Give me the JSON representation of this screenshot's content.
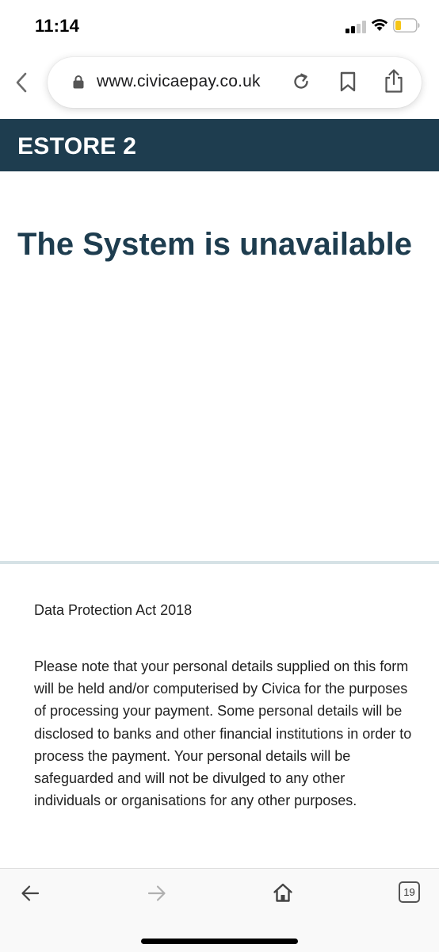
{
  "status_bar": {
    "time": "11:14",
    "icons": [
      "signal-icon",
      "wifi-icon",
      "battery-icon"
    ]
  },
  "browser": {
    "url": "www.civicaepay.co.uk",
    "icons": [
      "back-chevron-icon",
      "lock-icon",
      "reload-icon",
      "bookmark-icon",
      "share-icon"
    ]
  },
  "header": {
    "title": "ESTORE 2"
  },
  "main": {
    "heading": "The System is unavailable"
  },
  "footer": {
    "dpa_title": "Data Protection Act 2018",
    "dpa_text": "Please note that your personal details supplied on this form will be held and/or computerised by Civica for the purposes of processing your payment. Some personal details will be disclosed to banks and other financial institutions in order to process the payment. Your personal details will be safeguarded and will not be divulged to any other individuals or organisations for any other purposes."
  },
  "toolbar": {
    "tab_count": "19",
    "icons": [
      "arrow-left-icon",
      "arrow-right-icon",
      "home-icon",
      "tabs-icon"
    ]
  },
  "colors": {
    "brand": "#1e3d4f",
    "divider": "#d6e2e6"
  }
}
